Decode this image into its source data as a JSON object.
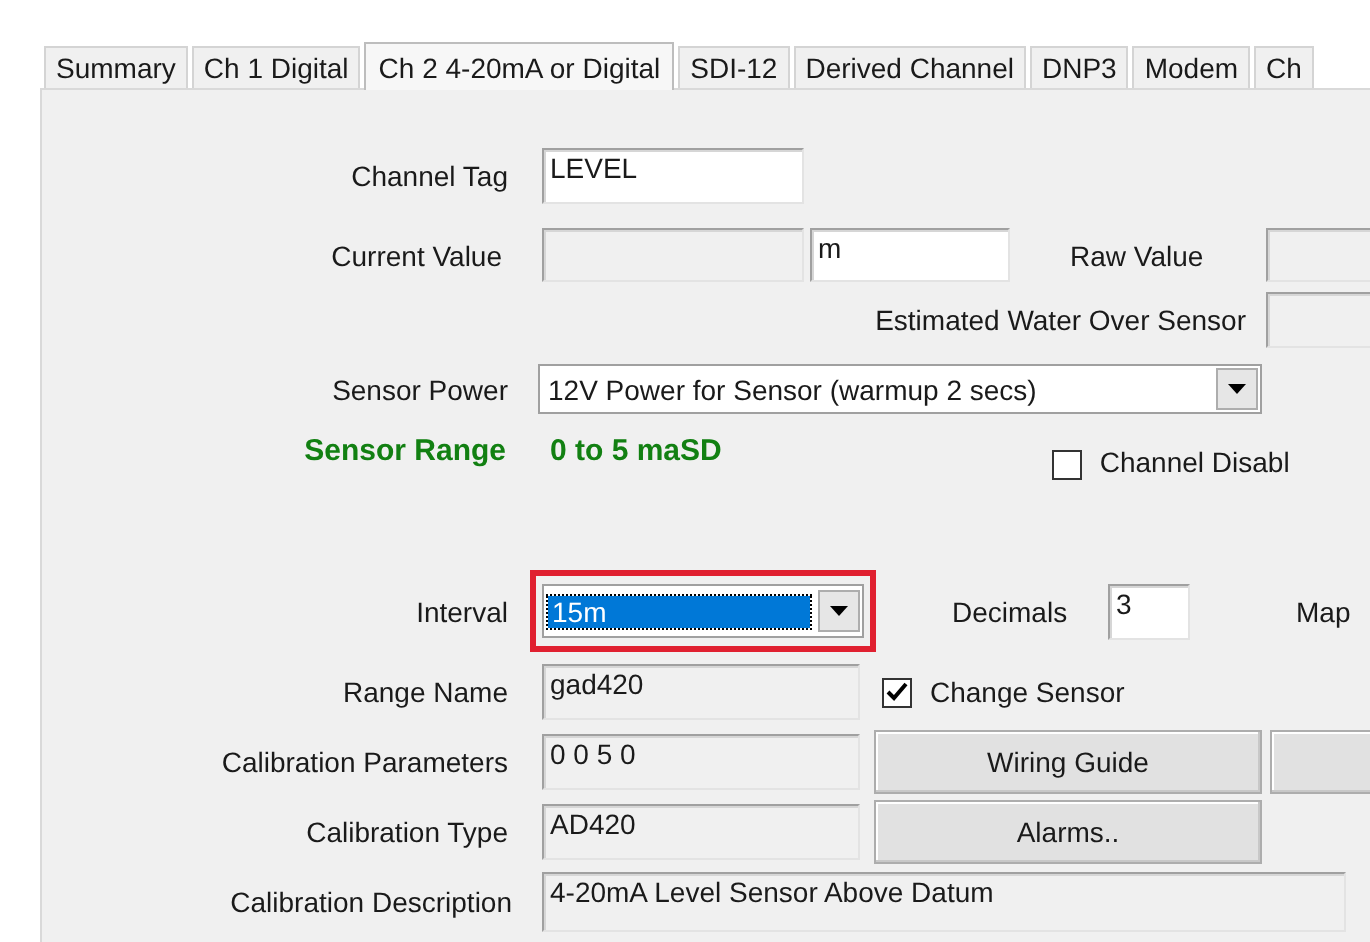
{
  "tabs": [
    {
      "label": "Summary",
      "selected": false
    },
    {
      "label": "Ch 1 Digital",
      "selected": false
    },
    {
      "label": "Ch 2 4-20mA or Digital",
      "selected": true
    },
    {
      "label": "SDI-12",
      "selected": false
    },
    {
      "label": "Derived Channel",
      "selected": false
    },
    {
      "label": "DNP3",
      "selected": false
    },
    {
      "label": "Modem",
      "selected": false
    },
    {
      "label": "Ch",
      "selected": false
    }
  ],
  "channel_tag": {
    "label": "Channel Tag",
    "field": {
      "value": "LEVEL",
      "disabled": false
    }
  },
  "current_value": {
    "label": "Current Value",
    "field": {
      "disabled": true
    },
    "units": {
      "value": "m",
      "disabled": false
    }
  },
  "raw_value": {
    "label": "Raw Value",
    "field": {
      "disabled": true
    }
  },
  "estimated_water_over_sensor": {
    "label": "Estimated Water Over Sensor",
    "field": {
      "disabled": true
    }
  },
  "sensor_power": {
    "label": "Sensor Power",
    "value": "12V Power for Sensor (warmup 2 secs)"
  },
  "sensor_range": {
    "label": "Sensor Range",
    "value": "0 to 5 maSD"
  },
  "channel_disable": {
    "label": "Channel Disabl",
    "checked": false
  },
  "interval": {
    "label": "Interval",
    "value": "15m",
    "focused": true,
    "highlighted": true
  },
  "decimals": {
    "label": "Decimals",
    "field": {
      "value": "3",
      "disabled": false
    }
  },
  "map": {
    "label": "Map"
  },
  "range_name": {
    "label": "Range Name",
    "field": {
      "value": "gad420",
      "disabled": true
    }
  },
  "change_sensor": {
    "label": "Change Sensor",
    "checked": true
  },
  "calibration_parameters": {
    "label": "Calibration Parameters",
    "field": {
      "value": "0 0 5 0",
      "disabled": true
    }
  },
  "wiring_guide_button": "Wiring Guide",
  "calibration_type": {
    "label": "Calibration Type",
    "field": {
      "value": "AD420",
      "disabled": true
    }
  },
  "alarms_button": "Alarms..",
  "calibration_description": {
    "label": "Calibration Description",
    "field": {
      "value": "4-20mA Level Sensor Above Datum",
      "disabled": true
    }
  }
}
